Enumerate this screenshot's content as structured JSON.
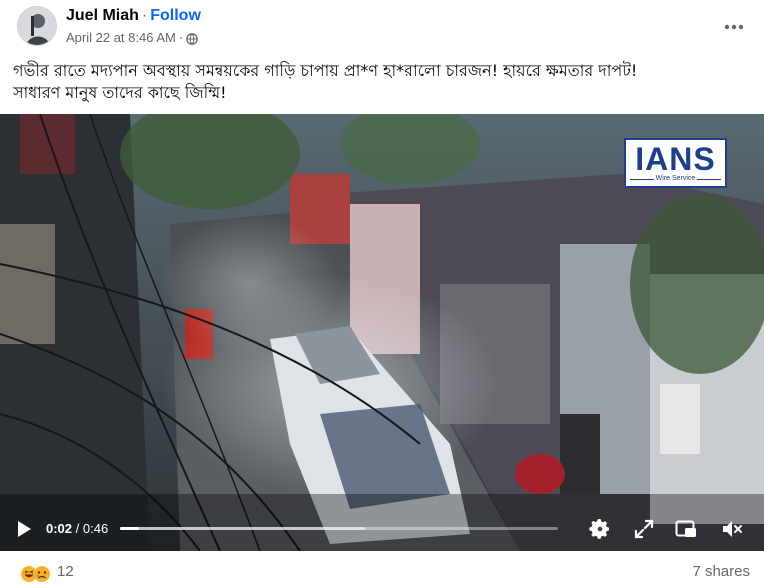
{
  "post": {
    "author": "Juel Miah",
    "separator": "·",
    "follow_label": "Follow",
    "timestamp": "April 22 at 8:46 AM",
    "meta_separator": "·",
    "privacy_icon": "globe-icon",
    "more_icon": "more-horizontal-icon",
    "text_line1": "গভীর রাতে মদ্যপান অবস্থায় সমন্বয়কের গাড়ি চাপায় প্রা*ণ হা*রালো চারজন! হায়রে ক্ষমতার দাপট!",
    "text_line2": "সাধারণ মানুষ তাদের কাছে জিম্মি!"
  },
  "video": {
    "watermark": "IANS",
    "watermark_sub": "Wire Service",
    "current_time": "0:02",
    "duration": " / 0:46",
    "progress_fraction": 0.043,
    "buffered_fraction": 0.56,
    "icons": [
      "play-icon",
      "settings-gear-icon",
      "fullscreen-expand-icon",
      "picture-in-picture-icon",
      "volume-muted-icon"
    ]
  },
  "footer": {
    "reaction_count": "12",
    "shares": "7 shares",
    "reaction_icons": [
      "haha-icon",
      "sad-icon"
    ]
  },
  "colors": {
    "follow": "#0866ff",
    "secondary_text": "#65676b",
    "ians_blue": "#1c3f8e"
  }
}
